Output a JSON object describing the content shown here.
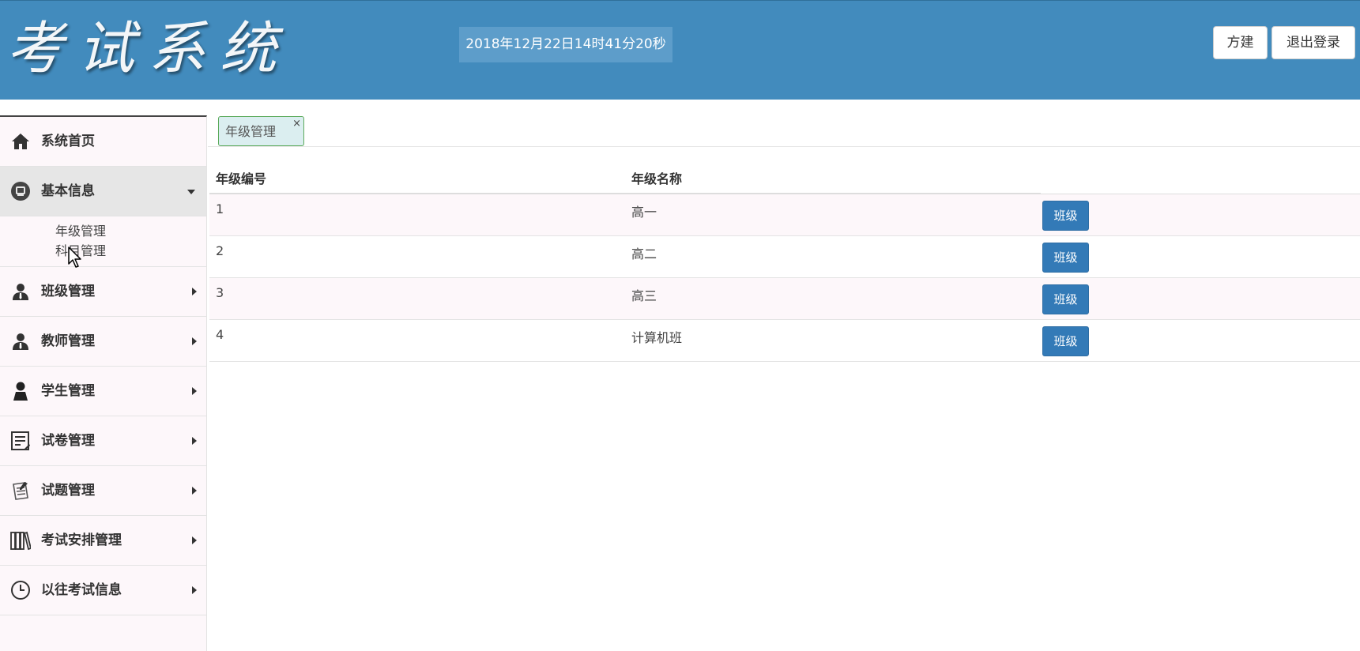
{
  "header": {
    "logo_text": "考试系统",
    "datetime": "2018年12月22日14时41分20秒",
    "user_label": "方建",
    "logout_label": "退出登录"
  },
  "sidebar": {
    "items": [
      {
        "label": "系统首页",
        "icon": "home-icon"
      },
      {
        "label": "基本信息",
        "icon": "info-circle-icon",
        "expanded": true,
        "sub_items": [
          "年级管理",
          "科目管理"
        ]
      },
      {
        "label": "班级管理",
        "icon": "user-tie-icon"
      },
      {
        "label": "教师管理",
        "icon": "user-tie-icon"
      },
      {
        "label": "学生管理",
        "icon": "user-icon"
      },
      {
        "label": "试卷管理",
        "icon": "document-edit-icon"
      },
      {
        "label": "试题管理",
        "icon": "question-list-icon"
      },
      {
        "label": "考试安排管理",
        "icon": "books-icon"
      },
      {
        "label": "以往考试信息",
        "icon": "clock-icon"
      }
    ]
  },
  "tabs": [
    {
      "label": "年级管理",
      "close": "×"
    }
  ],
  "table": {
    "headers": [
      "年级编号",
      "年级名称"
    ],
    "rows": [
      {
        "id": "1",
        "name": "高一",
        "action": "班级"
      },
      {
        "id": "2",
        "name": "高二",
        "action": "班级"
      },
      {
        "id": "3",
        "name": "高三",
        "action": "班级"
      },
      {
        "id": "4",
        "name": "计算机班",
        "action": "班级"
      }
    ]
  },
  "colors": {
    "header_bg": "#428bbd",
    "clock_bg": "#5d9dca",
    "primary_button": "#337ab7",
    "tab_bg": "#dbeef0",
    "tab_border": "#5cab5c"
  }
}
